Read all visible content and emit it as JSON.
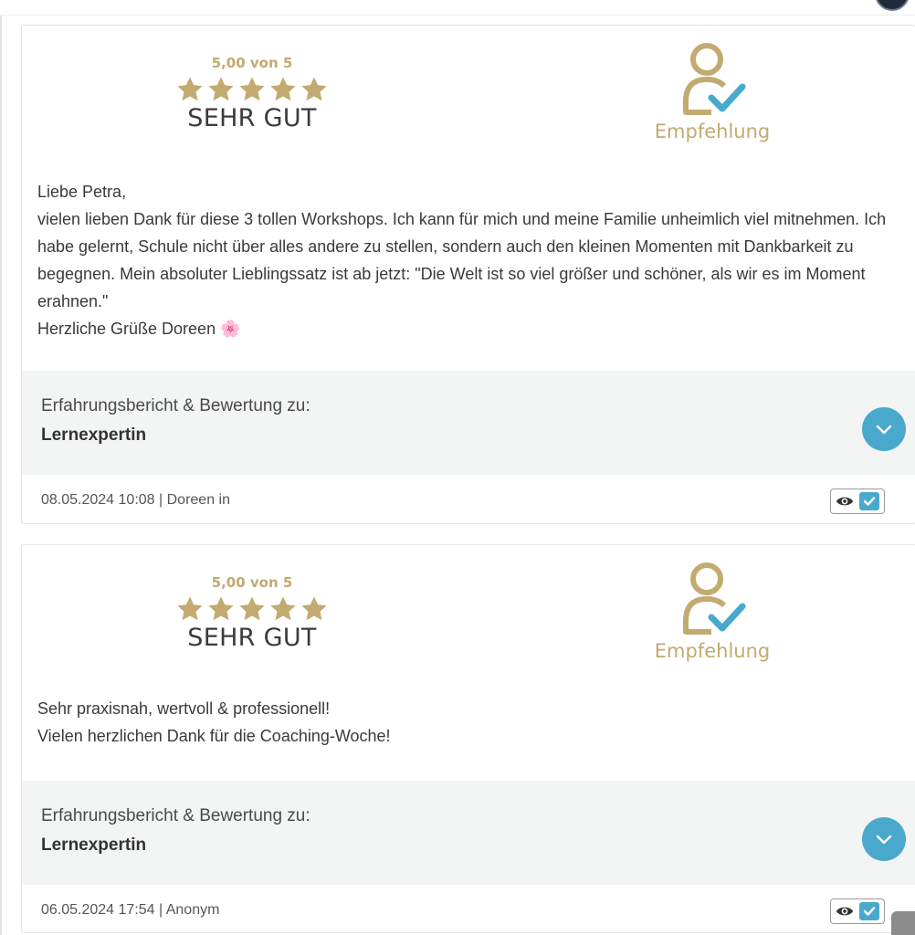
{
  "colors": {
    "gold": "#c2aa70",
    "accent_blue": "#49a9cc",
    "band_bg": "#f3f4f4"
  },
  "reviews": [
    {
      "score_text": "5,00 von 5",
      "stars": 5,
      "rating_label": "SEHR GUT",
      "recommend_label": "Empfehlung",
      "text": "Liebe Petra,\nvielen lieben Dank für diese 3 tollen Workshops. Ich kann für mich und meine Familie unheimlich viel mitnehmen. Ich habe gelernt, Schule nicht über alles andere zu stellen, sondern auch den kleinen Momenten mit Dankbarkeit zu begegnen. Mein absoluter Lieblingssatz ist ab jetzt: \"Die Welt ist so viel größer und schöner, als wir es im Moment erahnen.\"\nHerzliche Grüße Doreen 🌸",
      "subject_label": "Erfahrungsbericht & Bewertung zu:",
      "subject_name": "Lernexpertin",
      "meta": "08.05.2024 10:08 | Doreen in",
      "icons": [
        "star-icon",
        "recommend-user-check-icon",
        "chevron-down-icon",
        "eye-icon",
        "checkmark-icon"
      ]
    },
    {
      "score_text": "5,00 von 5",
      "stars": 5,
      "rating_label": "SEHR GUT",
      "recommend_label": "Empfehlung",
      "text": "Sehr praxisnah, wertvoll & professionell!\nVielen herzlichen Dank für die Coaching-Woche!",
      "subject_label": "Erfahrungsbericht & Bewertung zu:",
      "subject_name": "Lernexpertin",
      "meta": "06.05.2024 17:54 | Anonym",
      "icons": [
        "star-icon",
        "recommend-user-check-icon",
        "chevron-down-icon",
        "eye-icon",
        "checkmark-icon"
      ]
    }
  ]
}
